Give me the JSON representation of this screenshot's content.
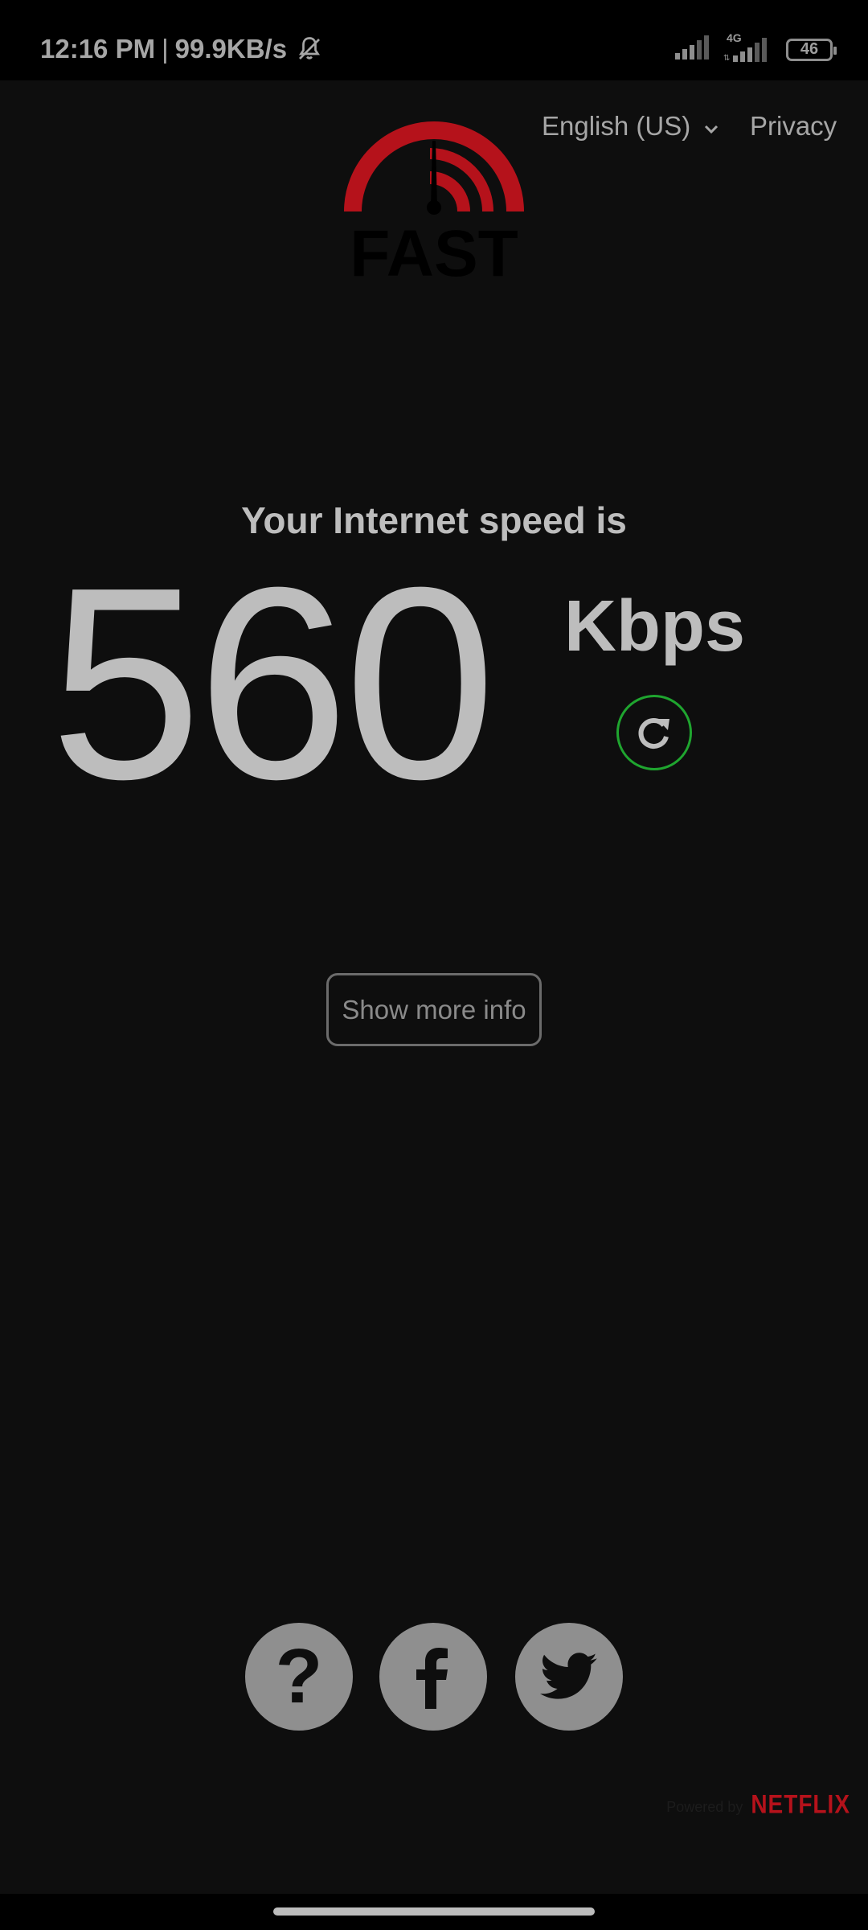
{
  "status_bar": {
    "time": "12:16 PM",
    "separator": "|",
    "net_speed": "99.9KB/s",
    "network_type": "4G",
    "battery": "46"
  },
  "nav": {
    "language": "English (US)",
    "privacy": "Privacy"
  },
  "logo": {
    "text": "FAST",
    "accent_color": "#b5121b"
  },
  "speed": {
    "caption": "Your Internet speed is",
    "value": "560",
    "unit": "Kbps"
  },
  "buttons": {
    "show_more": "Show more info"
  },
  "social": {
    "help_glyph": "?",
    "facebook_icon": "facebook-icon",
    "twitter_icon": "twitter-icon"
  },
  "footer": {
    "powered_by": "Powered by",
    "brand": "NETFLIX",
    "brand_color": "#b5121b"
  },
  "colors": {
    "background": "#0e0e0e",
    "refresh_ring": "#1fa52f"
  }
}
